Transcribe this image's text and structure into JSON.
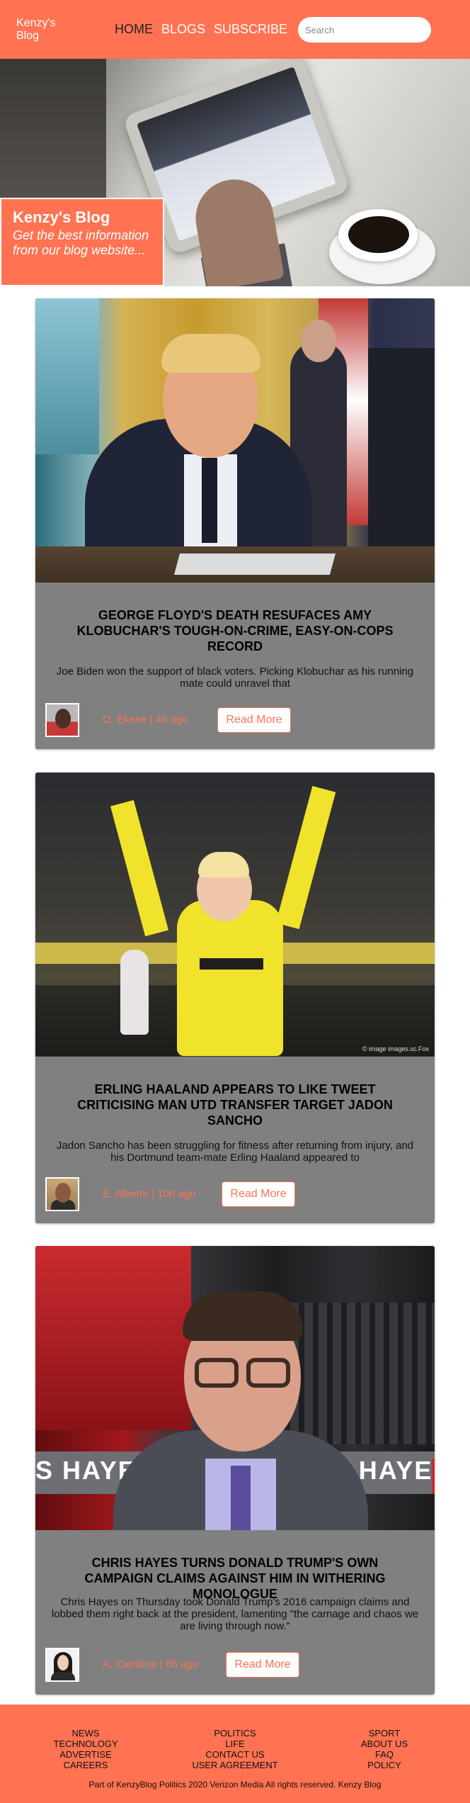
{
  "header": {
    "logo_line1": "Kenzy's",
    "logo_line2": "Blog",
    "nav": [
      "HOME",
      "BLOGS",
      "SUBSCRIBE"
    ],
    "search_placeholder": "Search"
  },
  "hero": {
    "title": "Kenzy's Blog",
    "subtitle": "Get the best information from our blog website..."
  },
  "articles": [
    {
      "title": "GEORGE FLOYD'S DEATH RESUFACES AMY KLOBUCHAR'S TOUGH-ON-CRIME, EASY-ON-COPS RECORD",
      "description": "Joe Biden won the support of black voters. Picking Klobuchar as his running mate could unravel that",
      "meta": "O. Ekene | 4h ago",
      "button": "Read More"
    },
    {
      "title": "ERLING HAALAND APPEARS TO LIKE TWEET CRITICISING MAN UTD TRANSFER TARGET JADON SANCHO",
      "description": "Jadon Sancho has been struggling for fitness after returning from injury, and his Dortmund team-mate Erling Haaland appeared to",
      "meta": "E. Alberto | 10h ago",
      "button": "Read More",
      "image_watermark": "© image images.sc.Fox"
    },
    {
      "title": "CHRIS HAYES TURNS DONALD TRUMP'S OWN CAMPAIGN CLAIMS AGAINST HIM IN WITHERING MONOLOGUE",
      "description": "Chris Hayes on Thursday took Donald Trump's 2016 campaign claims and lobbed them right back at the president, lamenting \"the carnage and chaos we are living through now.\"",
      "meta": "A. Camiline | 6h ago",
      "button": "Read More",
      "image_text": "S HAYES  ALL  WITH RIS HAYE"
    }
  ],
  "footer": {
    "col1": [
      "NEWS",
      "TECHNOLOGY",
      "ADVERTISE",
      "CAREERS"
    ],
    "col2": [
      "POLITICS",
      "LIFE",
      "CONTACT US",
      "USER AGREEMENT"
    ],
    "col3": [
      "SPORT",
      "ABOUT US",
      "FAQ",
      "POLICY"
    ],
    "copyright": "Part of KenzyBlog Politics 2020 Verizon Media All rights reserved. Kenzy Blog"
  },
  "colors": {
    "accent": "#ff7352",
    "card_bg": "#808080"
  }
}
